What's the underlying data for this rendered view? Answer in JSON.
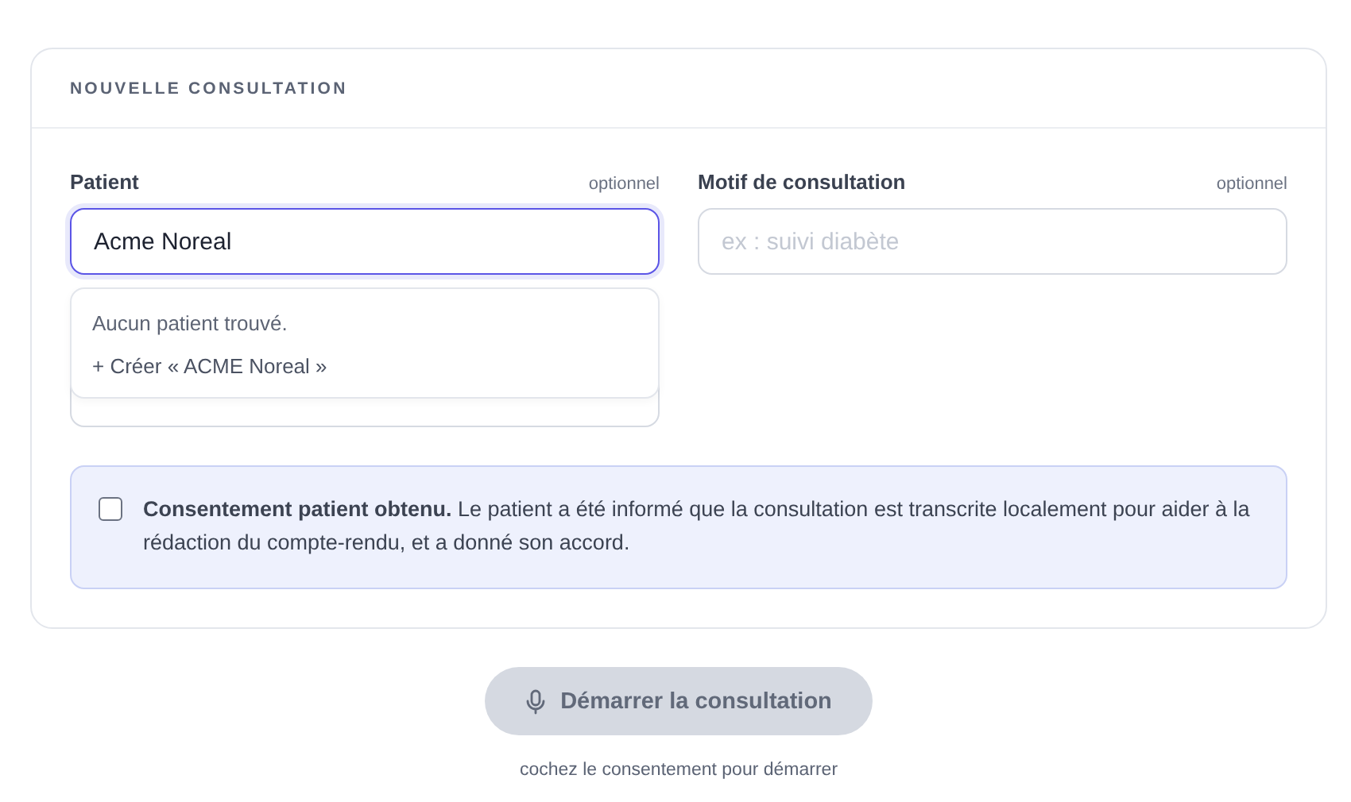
{
  "card": {
    "title": "NOUVELLE CONSULTATION"
  },
  "fields": [
    {
      "label": "Patient",
      "hint": "optionnel",
      "value": "Acme Noreal",
      "focused": true
    },
    {
      "label": "Motif de consultation",
      "hint": "optionnel",
      "placeholder": "ex : suivi diabète",
      "focused": false
    }
  ],
  "dropdown": {
    "items": [
      {
        "kind": "message",
        "text": "Aucun patient trouvé."
      },
      {
        "kind": "action",
        "text": "+ Créer « ACME Noreal »"
      }
    ]
  },
  "consent": {
    "checked": false,
    "text": "**Consentement patient obtenu.** Le patient a été informé que la consultation est transcrite localement pour aider à la rédaction du compte-rendu, et a donné son accord."
  },
  "start_button": {
    "label": "Démarrer la consultation",
    "disabled": true
  },
  "footer_hint": "cochez le consentement pour démarrer"
}
